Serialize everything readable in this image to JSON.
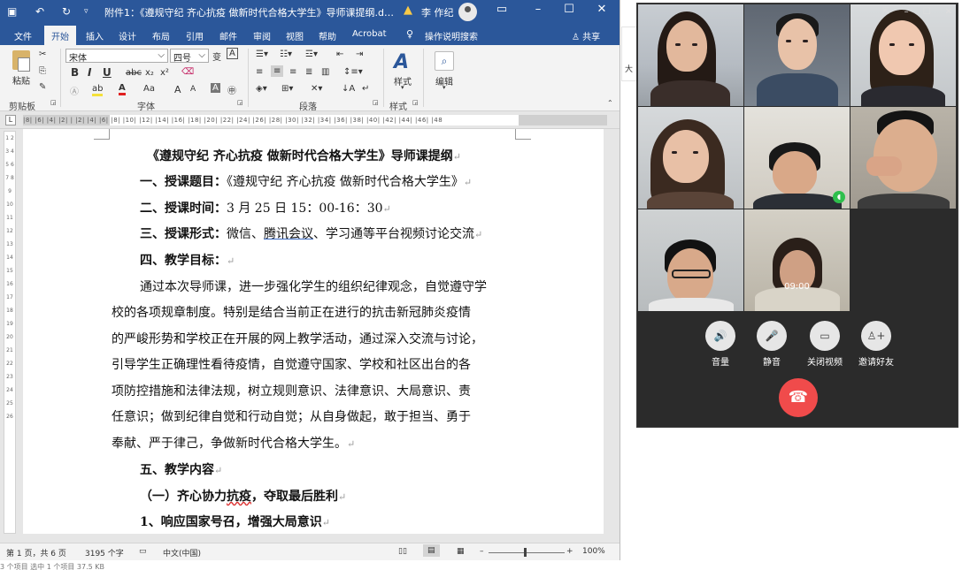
{
  "word": {
    "title": "附件1：《遵规守纪 齐心抗疫 做新时代合格大学生》导师课提纲.docx...",
    "user_name": "李 作纪",
    "tabs": [
      "文件",
      "开始",
      "插入",
      "设计",
      "布局",
      "引用",
      "邮件",
      "审阅",
      "视图",
      "帮助",
      "Acrobat"
    ],
    "active_tab": "开始",
    "tell_me": "操作说明搜索",
    "share": "共享",
    "ribbon": {
      "paste_label": "粘贴",
      "clipboard_label": "剪贴板",
      "font_name": "宋体",
      "font_size": "四号",
      "font_group_label": "字体",
      "paragraph_group_label": "段落",
      "styles_label": "样式",
      "styles_group_label": "样式",
      "edit_label": "编辑",
      "phonetic_label": "变",
      "box_char": "A",
      "bold": "B",
      "italic": "I",
      "underline": "U",
      "strike": "abc",
      "subscript": "x₂",
      "superscript": "x²",
      "case": "Aa",
      "grow": "A",
      "shrink": "A"
    },
    "ruler_text": "|8|  |6|  |4|  |2|  |  |2|  |4|  |6|  |8|  |10|  |12|  |14|  |16|  |18|  |20|  |22|  |24|  |26|  |28|  |30|  |32|  |34|  |36|  |38|  |40|  |42|  |44|  |46|  |48",
    "vruler_text": "1 2 3 4 5 6 7 8 9 10 11 12 13 14 15 16 17 18 19 20 21 22 23 24 25 26",
    "document": {
      "title": "《遵规守纪  齐心抗疫  做新时代合格大学生》导师课提纲",
      "items": [
        {
          "label": "一、授课题目：",
          "value": "《遵规守纪  齐心抗疫  做新时代合格大学生》"
        },
        {
          "label": "二、授课时间：",
          "value": "3 月 25 日  15：00-16：30"
        },
        {
          "label": "三、授课形式：",
          "value_before": "微信、",
          "value_link": "腾讯会议",
          "value_after": "、学习通等平台视频讨论交流"
        },
        {
          "label": "四、教学目标：",
          "value": ""
        }
      ],
      "paragraph_lines": [
        "通过本次导师课，进一步强化学生的组织纪律观念，自觉遵守学",
        "校的各项规章制度。特别是结合当前正在进行的抗击新冠肺炎疫情",
        "的严峻形势和学校正在开展的网上教学活动，通过深入交流与讨论，",
        "引导学生正确理性看待疫情，自觉遵守国家、学校和社区出台的各",
        "项防控措施和法律法规，树立规则意识、法律意识、大局意识、责",
        "任意识；做到纪律自觉和行动自觉；从自身做起，敢于担当、勇于",
        "奉献、严于律己，争做新时代合格大学生。"
      ],
      "section5": "五、教学内容",
      "sub1_before": "（一）齐心协力",
      "sub1_squiggle": "抗疫",
      "sub1_after": "，夺取最后胜利",
      "sub1_1": "1、响应国家号召，增强大局意识",
      "para_mark": "↵"
    },
    "status": {
      "page": "第 1 页，共 6 页",
      "words": "3195 个字",
      "language": "中文(中国)",
      "zoom": "100%"
    }
  },
  "explorer_status": "3 个项目    选中 1 个项目  37.5 KB",
  "bg_peek_text": "大",
  "call": {
    "timer": "09:00",
    "controls": [
      {
        "label": "音量",
        "icon": "speaker-icon",
        "glyph": "🔊"
      },
      {
        "label": "静音",
        "icon": "microphone-icon",
        "glyph": "🎤"
      },
      {
        "label": "关闭视频",
        "icon": "camera-icon",
        "glyph": "▭"
      },
      {
        "label": "邀请好友",
        "icon": "add-friend-icon",
        "glyph": "♙+"
      }
    ],
    "hangup_glyph": "☎"
  }
}
